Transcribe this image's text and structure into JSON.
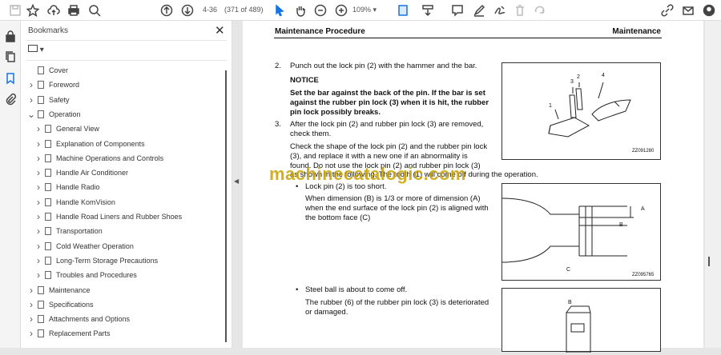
{
  "toolbar": {
    "page_label": "4-36",
    "page_count": "(371 of 489)",
    "zoom": "109%",
    "icons": [
      "save-icon",
      "star-icon",
      "cloud-upload-icon",
      "print-icon",
      "search-icon",
      "page-up-icon",
      "page-down-icon",
      "select-cursor-icon",
      "hand-icon",
      "zoom-out-icon",
      "zoom-in-icon",
      "fit-page-icon",
      "scroll-mode-icon",
      "comment-icon",
      "highlight-pen-icon",
      "sign-icon",
      "delete-icon",
      "rotate-icon",
      "share-link-icon",
      "email-icon",
      "account-icon"
    ],
    "accent": "#1473e6"
  },
  "sidebar": {
    "title": "Bookmarks",
    "items": [
      {
        "label": "Cover",
        "level": 0,
        "chev": ""
      },
      {
        "label": "Foreword",
        "level": 0,
        "chev": ">"
      },
      {
        "label": "Safety",
        "level": 0,
        "chev": ">"
      },
      {
        "label": "Operation",
        "level": 0,
        "chev": "v"
      },
      {
        "label": "General View",
        "level": 1,
        "chev": ">"
      },
      {
        "label": "Explanation of Components",
        "level": 1,
        "chev": ">"
      },
      {
        "label": "Machine Operations and Controls",
        "level": 1,
        "chev": ">"
      },
      {
        "label": "Handle Air Conditioner",
        "level": 1,
        "chev": ">"
      },
      {
        "label": "Handle Radio",
        "level": 1,
        "chev": ">"
      },
      {
        "label": "Handle KomVision",
        "level": 1,
        "chev": ">"
      },
      {
        "label": "Handle Road Liners and Rubber Shoes",
        "level": 1,
        "chev": ">"
      },
      {
        "label": "Transportation",
        "level": 1,
        "chev": ">"
      },
      {
        "label": "Cold Weather Operation",
        "level": 1,
        "chev": ">"
      },
      {
        "label": "Long-Term Storage Precautions",
        "level": 1,
        "chev": ">"
      },
      {
        "label": "Troubles and Procedures",
        "level": 1,
        "chev": ">"
      },
      {
        "label": "Maintenance",
        "level": 0,
        "chev": ">"
      },
      {
        "label": "Specifications",
        "level": 0,
        "chev": ">"
      },
      {
        "label": "Attachments and Options",
        "level": 0,
        "chev": ">"
      },
      {
        "label": "Replacement Parts",
        "level": 0,
        "chev": ">"
      }
    ]
  },
  "doc": {
    "header_left": "Maintenance Procedure",
    "header_right": "Maintenance",
    "step2_num": "2.",
    "step2": "Punch out the lock pin (2) with the hammer and the bar.",
    "notice_title": "NOTICE",
    "notice": [
      "Set the bar against the back of the pin. If the bar is set",
      "against the rubber pin lock (3) when it is hit, the rubber",
      "pin lock possibly breaks."
    ],
    "step3_num": "3.",
    "step3": [
      "After the lock pin (2) and rubber pin lock (3) are removed,",
      "check them."
    ],
    "para": [
      "Check the shape of the lock pin (2) and the rubber pin lock",
      "(3), and replace it with a new one if an abnormality is",
      "found. Do not use the lock pin (2) and rubber pin lock (3)",
      "as shown in the following. The tooth (1) will come off during the operation."
    ],
    "bullet1": "Lock pin (2) is too short.",
    "bullet1_text": [
      "When dimension (B) is 1/3 or more of dimension (A)",
      "when the end surface of the lock pin (2) is aligned with",
      "the bottom face (C)"
    ],
    "bullet2": "Steel ball is about to come off.",
    "bullet2_text": [
      "The rubber (6) of the rubber pin lock (3) is deteriorated",
      "or damaged."
    ],
    "fig1_code": "ZZ091280",
    "fig2_code": "ZZ095765",
    "fig1_labels": [
      "1",
      "2",
      "3",
      "4"
    ],
    "fig2_labels": [
      "A",
      "B",
      "C"
    ],
    "fig3_labels": [
      "B"
    ],
    "watermark": "machinecatalogic.com"
  }
}
